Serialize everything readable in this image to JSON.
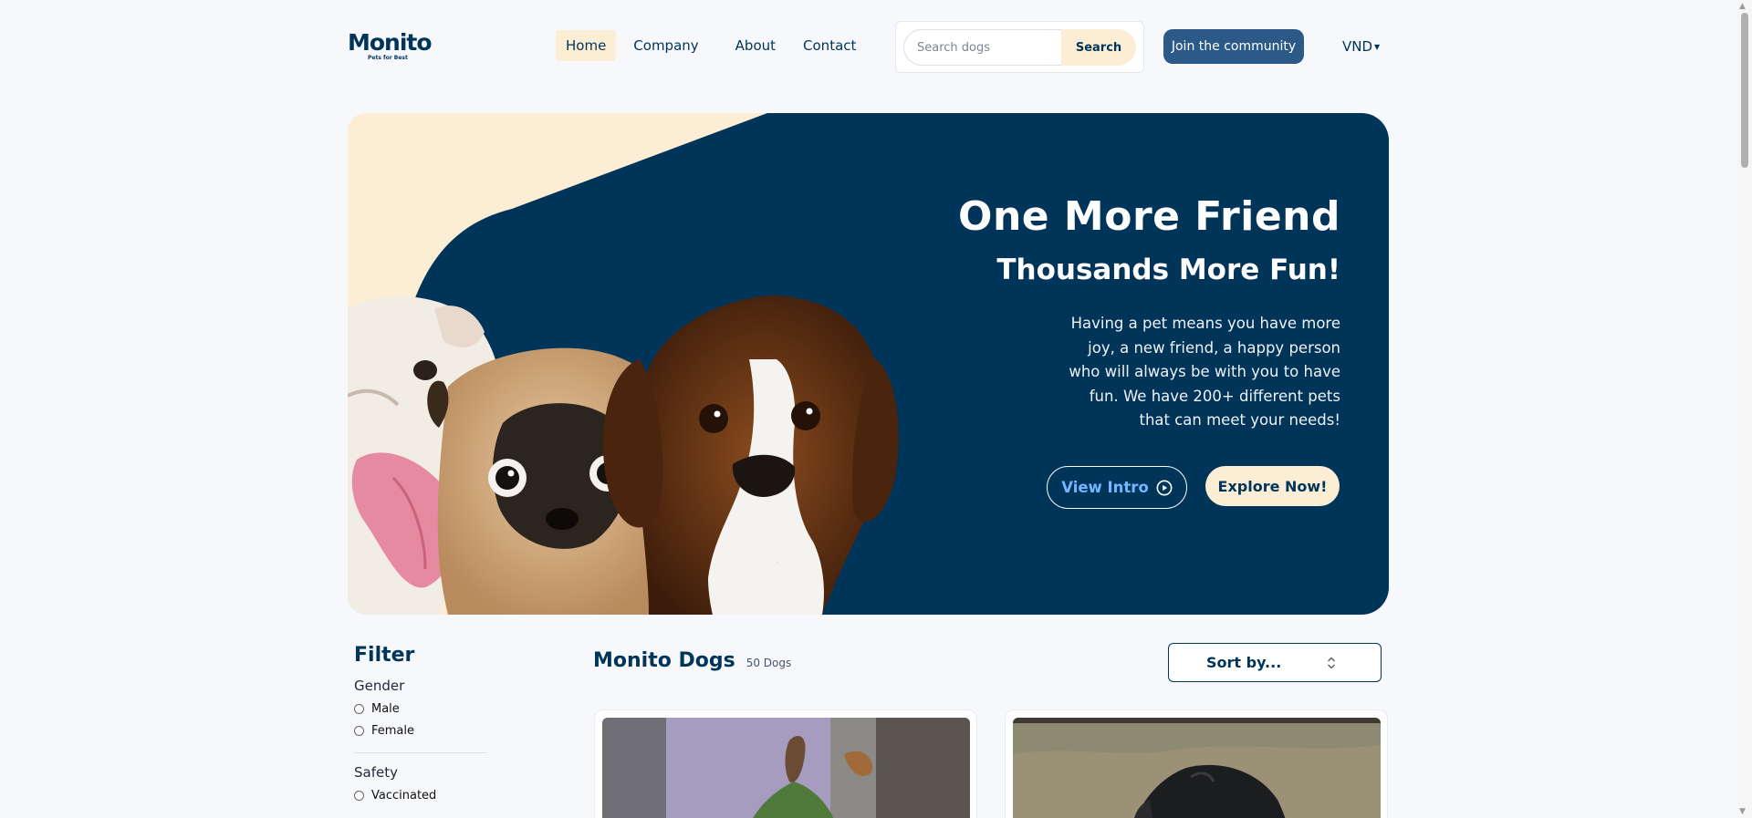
{
  "header": {
    "logo_word": "Monito",
    "logo_tagline": "Pets for Best",
    "nav": [
      {
        "label": "Home",
        "active": true
      },
      {
        "label": "Company",
        "active": false
      },
      {
        "label": "About",
        "active": false
      },
      {
        "label": "Contact",
        "active": false
      }
    ],
    "search": {
      "placeholder": "Search dogs",
      "button_label": "Search"
    },
    "join_label": "Join the community",
    "currency": "VND"
  },
  "hero": {
    "title": "One More Friend",
    "subtitle": "Thousands More Fun!",
    "description": "Having a pet means you have more joy, a new friend, a happy person who will always be with you to have fun. We have 200+ different pets that can meet your needs!",
    "intro_label": "View Intro",
    "explore_label": "Explore Now!"
  },
  "filter": {
    "title": "Filter",
    "groups": [
      {
        "title": "Gender",
        "options": [
          "Male",
          "Female"
        ]
      },
      {
        "title": "Safety",
        "options": [
          "Vaccinated"
        ]
      }
    ]
  },
  "products": {
    "title": "Monito Dogs",
    "count": "50 Dogs",
    "sort_label": "Sort by..."
  },
  "colors": {
    "navy": "#003459",
    "cream": "#fceed5",
    "accent_blue": "#2b5a88",
    "intro_text": "#73b6ff"
  }
}
